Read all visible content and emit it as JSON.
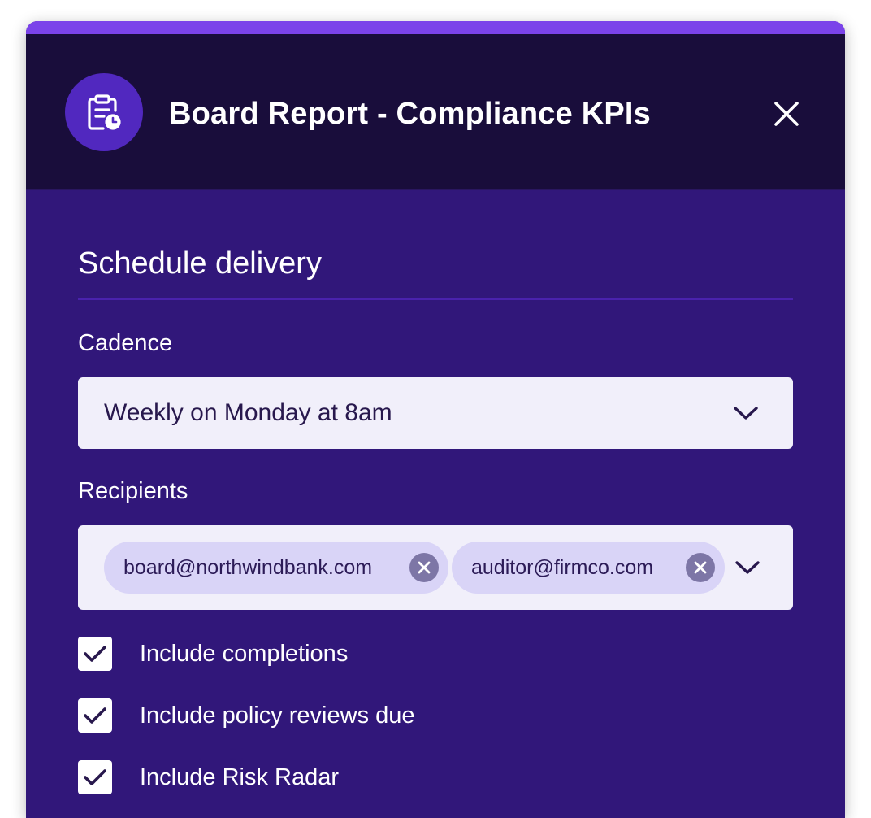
{
  "modal": {
    "title": "Board Report - Compliance KPIs",
    "header_icon": "clipboard-clock-icon",
    "close_icon": "close-icon"
  },
  "schedule": {
    "section_title": "Schedule delivery",
    "cadence": {
      "label": "Cadence",
      "value": "Weekly on Monday at 8am",
      "icon": "chevron-down-icon"
    },
    "recipients": {
      "label": "Recipients",
      "chips": [
        {
          "email": "board@northwindbank.com",
          "remove_icon": "remove-icon"
        },
        {
          "email": "auditor@firmco.com",
          "remove_icon": "remove-icon"
        }
      ],
      "icon": "chevron-down-icon"
    },
    "options": [
      {
        "label": "Include completions",
        "checked": true
      },
      {
        "label": "Include policy reviews due",
        "checked": true
      },
      {
        "label": "Include Risk Radar",
        "checked": true
      }
    ]
  },
  "colors": {
    "accent": "#7b43ea",
    "header_bg": "#190d3b",
    "body_bg": "#31177a",
    "icon_circle": "#5128bf",
    "field_bg": "#f1effa",
    "chip_bg": "#d9d4f7"
  }
}
